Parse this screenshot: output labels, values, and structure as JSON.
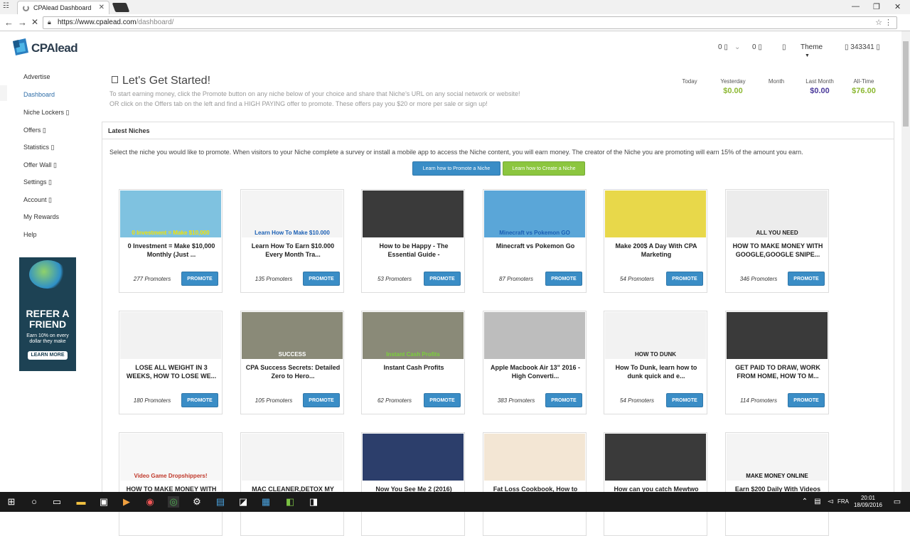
{
  "browser": {
    "tab_title": "CPAlead Dashboard",
    "url_domain": "https://www.cpalead.com",
    "url_path": "/dashboard/"
  },
  "header": {
    "logo_text": "CPAlead",
    "counter1": "0 ▯",
    "counter2": "0 ▯",
    "theme_label": "Theme",
    "user_id": "▯ 343341 ▯"
  },
  "sidebar": {
    "items": [
      {
        "label": "Advertise"
      },
      {
        "label": "Dashboard"
      },
      {
        "label": "Niche Lockers ▯"
      },
      {
        "label": "Offers ▯"
      },
      {
        "label": "Statistics ▯"
      },
      {
        "label": "Offer Wall ▯"
      },
      {
        "label": "Settings ▯"
      },
      {
        "label": "Account ▯"
      },
      {
        "label": "My Rewards"
      },
      {
        "label": "Help"
      }
    ],
    "refer": {
      "title": "REFER A FRIEND",
      "sub": "Earn 10% on every dollar they make",
      "button": "LEARN MORE"
    }
  },
  "get_started": {
    "title": "Let's Get Started!",
    "line1": "To start earning money, click the Promote button on any niche below of your choice and share that Niche's URL on any social network or website!",
    "line2": "OR click on the Offers tab on the left and find a HIGH PAYING offer to promote. These offers pay you $20 or more per sale or sign up!"
  },
  "stats": [
    {
      "label": "Today",
      "value": "",
      "color": "#555555"
    },
    {
      "label": "Yesterday",
      "value": "$0.00",
      "color": "#8cb832"
    },
    {
      "label": "Month",
      "value": "",
      "color": "#555555"
    },
    {
      "label": "Last Month",
      "value": "$0.00",
      "color": "#4b3a9b"
    },
    {
      "label": "All-Time",
      "value": "$76.00",
      "color": "#8cb832"
    }
  ],
  "panel": {
    "heading": "Latest Niches",
    "intro": "Select the niche you would like to promote. When visitors to your Niche complete a survey or install a mobile app to access the Niche content, you will earn money. The creator of the Niche you are promoting will earn 15% of the amount you earn.",
    "btn_promote": "Learn how to Promote a Niche",
    "btn_create": "Learn how to Create a Niche",
    "promote_label": "PROMOTE"
  },
  "niches": [
    {
      "title": "0 Investment = Make $10,000 Monthly (Just ...",
      "promoters": "277 Promoters",
      "thumb_caption": "0 Investment = Make $10,000",
      "thumb_color": "#7fc2e0",
      "cap_color": "#f5e400"
    },
    {
      "title": "Learn How To Earn $10.000 Every Month Tra...",
      "promoters": "135 Promoters",
      "thumb_caption": "Learn How To Make $10.000",
      "thumb_color": "#f4f4f4",
      "cap_color": "#1a5fb4"
    },
    {
      "title": "How to be Happy - The Essential Guide -",
      "promoters": "53 Promoters",
      "thumb_caption": "",
      "thumb_color": "#3a3a3a",
      "cap_color": "#ffffff"
    },
    {
      "title": "Minecraft vs Pokemon Go",
      "promoters": "87 Promoters",
      "thumb_caption": "Minecraft vs Pokemon GO",
      "thumb_color": "#5aa6d8",
      "cap_color": "#1a5fb4"
    },
    {
      "title": "Make 200$ A Day With CPA Marketing",
      "promoters": "54 Promoters",
      "thumb_caption": "",
      "thumb_color": "#e8d84a",
      "cap_color": "#ffffff"
    },
    {
      "title": "HOW TO MAKE MONEY WITH GOOGLE,GOOGLE SNIPE...",
      "promoters": "346 Promoters",
      "thumb_caption": "ALL YOU NEED",
      "thumb_color": "#ececec",
      "cap_color": "#222222"
    },
    {
      "title": "LOSE ALL WEIGHT IN 3 WEEKS, HOW TO LOSE WE...",
      "promoters": "180 Promoters",
      "thumb_caption": "",
      "thumb_color": "#f2f2f2",
      "cap_color": "#ffffff"
    },
    {
      "title": "CPA Success Secrets: Detailed Zero to Hero...",
      "promoters": "105 Promoters",
      "thumb_caption": "SUCCESS",
      "thumb_color": "#8a8a78",
      "cap_color": "#ffffff"
    },
    {
      "title": "Instant Cash Profits",
      "promoters": "62 Promoters",
      "thumb_caption": "Instant Cash Profits",
      "thumb_color": "#8a8a78",
      "cap_color": "#7ad13a"
    },
    {
      "title": "Apple Macbook Air 13\" 2016 - High Converti...",
      "promoters": "383 Promoters",
      "thumb_caption": "",
      "thumb_color": "#bdbdbd",
      "cap_color": "#ffffff"
    },
    {
      "title": "How To Dunk, learn how to dunk quick and e...",
      "promoters": "54 Promoters",
      "thumb_caption": "HOW TO DUNK",
      "thumb_color": "#f2f2f2",
      "cap_color": "#222222"
    },
    {
      "title": "GET PAID TO DRAW, WORK FROM HOME, HOW TO M...",
      "promoters": "114 Promoters",
      "thumb_caption": "",
      "thumb_color": "#3a3a3a",
      "cap_color": "#ffffff"
    },
    {
      "title": "HOW TO MAKE MONEY WITH",
      "promoters": "",
      "thumb_caption": "Video Game Dropshippers!",
      "thumb_color": "#f7f7f7",
      "cap_color": "#c0392b"
    },
    {
      "title": "MAC CLEANER,DETOX MY",
      "promoters": "",
      "thumb_caption": "",
      "thumb_color": "#f4f4f4",
      "cap_color": "#ffffff"
    },
    {
      "title": "Now You See Me 2 (2016)",
      "promoters": "",
      "thumb_caption": "",
      "thumb_color": "#2c3e6b",
      "cap_color": "#ffffff"
    },
    {
      "title": "Fat Loss Cookbook, How to",
      "promoters": "",
      "thumb_caption": "",
      "thumb_color": "#f3e6d4",
      "cap_color": "#ffffff"
    },
    {
      "title": "How can you catch Mewtwo",
      "promoters": "",
      "thumb_caption": "",
      "thumb_color": "#3a3a3a",
      "cap_color": "#ffffff"
    },
    {
      "title": "Earn $200 Daily With Videos",
      "promoters": "",
      "thumb_caption": "MAKE MONEY ONLINE",
      "thumb_color": "#f4f4f4",
      "cap_color": "#111111"
    }
  ],
  "taskbar": {
    "lang": "FRA",
    "time": "20:01",
    "date": "18/09/2016"
  }
}
